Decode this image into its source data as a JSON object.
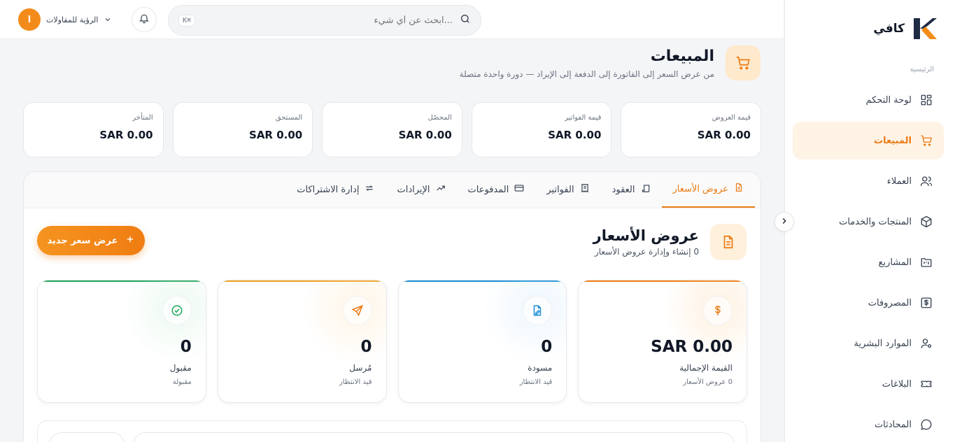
{
  "app": {
    "name": "كافي"
  },
  "sidebar": {
    "section_label": "الرئيسية",
    "items": [
      {
        "label": "لوحة التحكم",
        "icon": "dashboard-grid-icon",
        "active": false
      },
      {
        "label": "المبيعات",
        "icon": "cart-icon",
        "active": true
      },
      {
        "label": "العملاء",
        "icon": "users-icon",
        "active": false
      },
      {
        "label": "المنتجات والخدمات",
        "icon": "box-icon",
        "active": false
      },
      {
        "label": "المشاريع",
        "icon": "folder-kanban-icon",
        "active": false
      },
      {
        "label": "المصروفات",
        "icon": "dollar-square-icon",
        "active": false
      },
      {
        "label": "الموارد البشرية",
        "icon": "user-gear-icon",
        "active": false
      },
      {
        "label": "البلاغات",
        "icon": "ticket-icon",
        "active": false
      },
      {
        "label": "المحادثات",
        "icon": "chat-icon",
        "active": false
      }
    ]
  },
  "topbar": {
    "search_placeholder": "...ابحث عن أي شيء",
    "shortcut": "⌘K",
    "account_name": "الرؤية للمقاولات",
    "avatar_letter": "ا"
  },
  "page": {
    "title": "المبيعات",
    "subtitle": "من عرض السعر إلى الفاتورة إلى الدفعة إلى الإيراد — دورة واحدة متصلة"
  },
  "stats": [
    {
      "label": "قيمة العروض",
      "value": "SAR 0.00"
    },
    {
      "label": "قيمة الفواتير",
      "value": "SAR 0.00"
    },
    {
      "label": "المحصّل",
      "value": "SAR 0.00"
    },
    {
      "label": "المستحق",
      "value": "SAR 0.00"
    },
    {
      "label": "المتأخر",
      "value": "SAR 0.00"
    }
  ],
  "tabs": [
    {
      "label": "عروض الأسعار",
      "active": true
    },
    {
      "label": "العقود",
      "active": false
    },
    {
      "label": "الفواتير",
      "active": false
    },
    {
      "label": "المدفوعات",
      "active": false
    },
    {
      "label": "الإيرادات",
      "active": false
    },
    {
      "label": "إدارة الاشتراكات",
      "active": false
    }
  ],
  "section": {
    "title": "عروض الأسعار",
    "subtitle": "0 إنشاء وإدارة عروض الأسعار",
    "new_button": "عرض سعر جديد"
  },
  "kpis": [
    {
      "value": "SAR 0.00",
      "label": "القيمة الإجمالية",
      "sub": "0 عروض الأسعار",
      "color": "#f07d12",
      "icon": "dollar-icon"
    },
    {
      "value": "0",
      "label": "مسودة",
      "sub": "قيد الانتظار",
      "color": "#1e90d6",
      "icon": "file-edit-icon"
    },
    {
      "value": "0",
      "label": "مُرسل",
      "sub": "قيد الانتظار",
      "color": "#f0a020",
      "icon": "send-icon"
    },
    {
      "value": "0",
      "label": "مقبول",
      "sub": "مقبولة",
      "color": "#22a55a",
      "icon": "check-circle-icon"
    }
  ],
  "colors": {
    "accent": "#f07d12",
    "accent_soft": "#fff3e6"
  }
}
